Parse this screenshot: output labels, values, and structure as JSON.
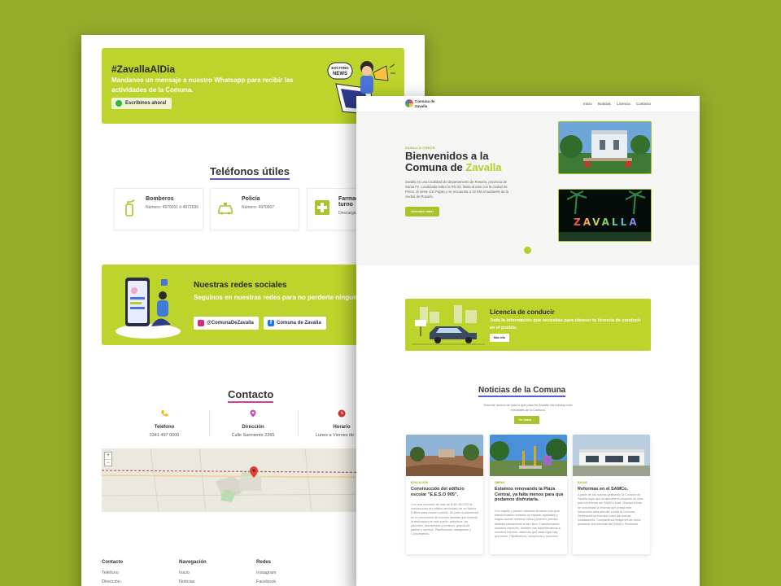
{
  "back": {
    "whatsapp_banner": {
      "title": "#ZavallaAlDia",
      "text": "Mandanos un mensaje a nuestro Whatsapp para recibir las actividades de la Comuna.",
      "button": "Escribinos ahora!",
      "sign": "EXCITING NEWS"
    },
    "phones": {
      "title": "Teléfonos útiles",
      "items": [
        {
          "title": "Bomberos",
          "detail": "Número: 4970051 ó 4972036"
        },
        {
          "title": "Policía",
          "detail": "Número: 4970007"
        },
        {
          "title": "Farmacia de turno",
          "detail": "Descargá..."
        }
      ]
    },
    "social": {
      "title": "Nuestras redes sociales",
      "text": "Seguinos en nuestras redes para no perderte ninguna novedad del pueblo.",
      "instagram": "@ComunaDeZavalla",
      "facebook": "Comuna de Zavalla"
    },
    "contact": {
      "title": "Contacto",
      "items": [
        {
          "title": "Teléfono",
          "detail": "0341 497 0000"
        },
        {
          "title": "Dirección",
          "detail": "Calle Sarmiento 2365"
        },
        {
          "title": "Horario",
          "detail": "Lunes a Viernes de 7 a 13"
        }
      ]
    },
    "map": {
      "zoom_in": "+",
      "zoom_out": "−"
    },
    "footer": {
      "columns": [
        {
          "heading": "Contacto",
          "items": [
            "Teléfono",
            "Dirección"
          ]
        },
        {
          "heading": "Navegación",
          "items": [
            "Inicio",
            "Noticias"
          ]
        },
        {
          "heading": "Redes",
          "items": [
            "Instagram",
            "Facebook"
          ]
        }
      ]
    }
  },
  "front": {
    "brand": {
      "line1": "Comuna de",
      "line2": "Zavalla"
    },
    "nav": [
      "Inicio",
      "Noticias",
      "Licencia",
      "Contacto"
    ],
    "hero": {
      "eyebrow": "ZAVALLA CRECE",
      "title_1": "Bienvenidos a la",
      "title_2": "Comuna de ",
      "title_highlight": "Zavalla",
      "text": "Zavalla es una localidad del departamento de Rosario, provincia de Santa Fe. Localizada sobre la RN 33, limita al este con la ciudad de Pérez, al oeste con Pujato y se encuentra a 22 KM al sudoeste de la ciudad de Rosario.",
      "button": "Descubrí más!",
      "sign_text": "ZAVALLA"
    },
    "license": {
      "title": "Licencia de conducir",
      "text": "Toda la información que necesitas para obtener tu licencia de conducir en el pueblo.",
      "button": "Más info"
    },
    "news": {
      "title": "Noticias de la Comuna",
      "subtitle": "Enterate acerca de todo lo que pasa en Zavalla, las noticias más relevantes de la Comuna.",
      "button": "Ver todas →",
      "cards": [
        {
          "category": "EDUCACIÓN",
          "title": "Construcción del edificio escolar \"E.E.S.O 905\".",
          "body": "Con una inversión de más de $150.000.000 la construcción del edificio secundario de un Nuevo Edificio para nuestro pueblo. Un paso fundamental en el crecimiento de muchas familias que fomenta la realización de este sueño: directivos, los docentes, preceptores y porteros, grupos de padres y vecinos. Planificamos, trabajamos y Concretamos."
        },
        {
          "category": "OBRAS",
          "title": "Estamos renovando la Plaza Central, ya falta menos para que podamos disfrutarla.",
          "body": "Con orgullo y pasión, estamos llevando una gran transformación creando un espacio agradable y seguro donde nuestros niños y jóvenes puedan disfrutar plenamente al aire libre. Transformando nuestros espacios, también nos transformamos a nosotros mismos, sabiendo que cada lugar hay que hacer. Planificamos, cumplimos y hacemos."
        },
        {
          "category": "SALUD",
          "title": "Reformas en el SAMCo.",
          "body": "A partir de las nuevas gestiones, la Comuna de Zavalla logró que se apruebe el proyecto de obra para la reforma del SAMCo local. Gracias a esto se concretará la reforma que presta este nosocomio para atender a toda la Comuna. Destinando la inversión para las nuevas instalaciones. Compartimos imágenes de cómo quedarán las reformas del SAMCo Provincial."
        }
      ]
    }
  }
}
